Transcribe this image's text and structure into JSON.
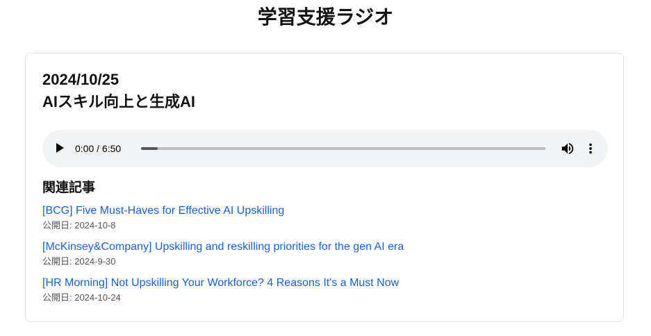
{
  "site": {
    "title": "学習支援ラジオ"
  },
  "episode": {
    "date": "2024/10/25",
    "title": "AIスキル向上と生成AI",
    "player": {
      "time_display": "0:00 / 6:50",
      "progress": 0.0
    }
  },
  "related": {
    "heading": "関連記事",
    "items": [
      {
        "title": "[BCG] Five Must-Haves for Effective AI Upskilling",
        "date": "公開日: 2024-10-8"
      },
      {
        "title": "[McKinsey&Company] Upskilling and reskilling priorities for the gen AI era",
        "date": "公開日: 2024-9-30"
      },
      {
        "title": "[HR Morning] Not Upskilling Your Workforce? 4 Reasons It's a Must Now",
        "date": "公開日: 2024-10-24"
      }
    ]
  },
  "colors": {
    "link": "#1a5fd1",
    "player_bg": "#f1f3f4",
    "card_border": "#dfe1e5"
  }
}
